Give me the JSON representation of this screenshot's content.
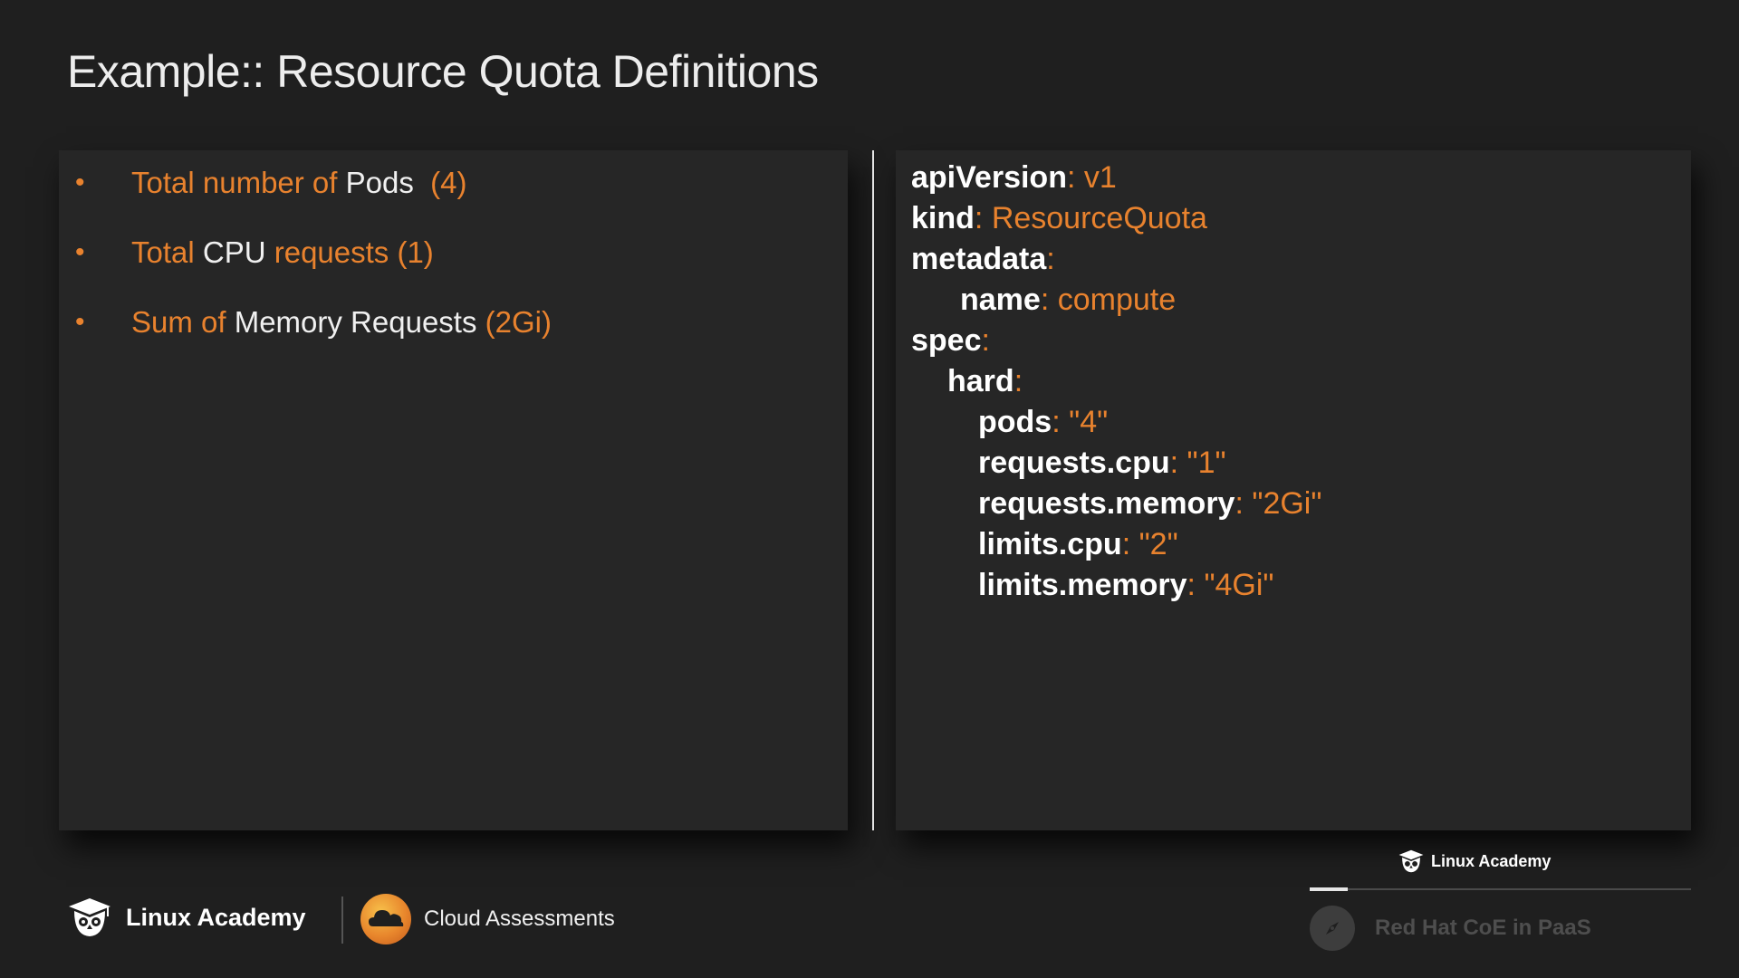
{
  "slide": {
    "title": "Example:: Resource Quota Definitions"
  },
  "bullets": [
    {
      "parts": [
        {
          "text": "Total number of ",
          "hl": true
        },
        {
          "text": "Pods",
          "hl": false
        },
        {
          "text": "  (4)",
          "hl": true
        }
      ]
    },
    {
      "parts": [
        {
          "text": "Total ",
          "hl": true
        },
        {
          "text": "CPU",
          "hl": false
        },
        {
          "text": " requests (1)",
          "hl": true
        }
      ]
    },
    {
      "parts": [
        {
          "text": "Sum of ",
          "hl": true
        },
        {
          "text": "Memory Requests",
          "hl": false
        },
        {
          "text": " (2Gi)",
          "hl": true
        }
      ]
    }
  ],
  "code": [
    {
      "indent": 0,
      "key": "apiVersion",
      "value": "v1"
    },
    {
      "indent": 0,
      "key": "kind",
      "value": "ResourceQuota"
    },
    {
      "indent": 0,
      "key": "metadata",
      "value": ""
    },
    {
      "indent": 1,
      "key": "name",
      "value": "compute"
    },
    {
      "indent": 0,
      "key": "spec",
      "value": ""
    },
    {
      "indent": 3,
      "key": "hard",
      "value": ""
    },
    {
      "indent": 2,
      "key": "pods",
      "value": "\"4\""
    },
    {
      "indent": 2,
      "key": "requests.cpu",
      "value": "\"1\""
    },
    {
      "indent": 2,
      "key": "requests.memory",
      "value": "\"2Gi\""
    },
    {
      "indent": 2,
      "key": "limits.cpu",
      "value": "\"2\""
    },
    {
      "indent": 2,
      "key": "limits.memory",
      "value": "\"4Gi\""
    }
  ],
  "footer": {
    "brand_label": "Linux Academy",
    "product_label": "Cloud Assessments",
    "player_brand_label": "Linux Academy",
    "course_label": "Red Hat CoE in PaaS",
    "progress_fraction": 0.1
  },
  "colors": {
    "accent": "#e8822e",
    "background": "#1f1f1f",
    "panel": "#262626"
  },
  "icons": {
    "brand": "owl-icon",
    "product": "cloud-icon",
    "course": "compass-icon"
  }
}
